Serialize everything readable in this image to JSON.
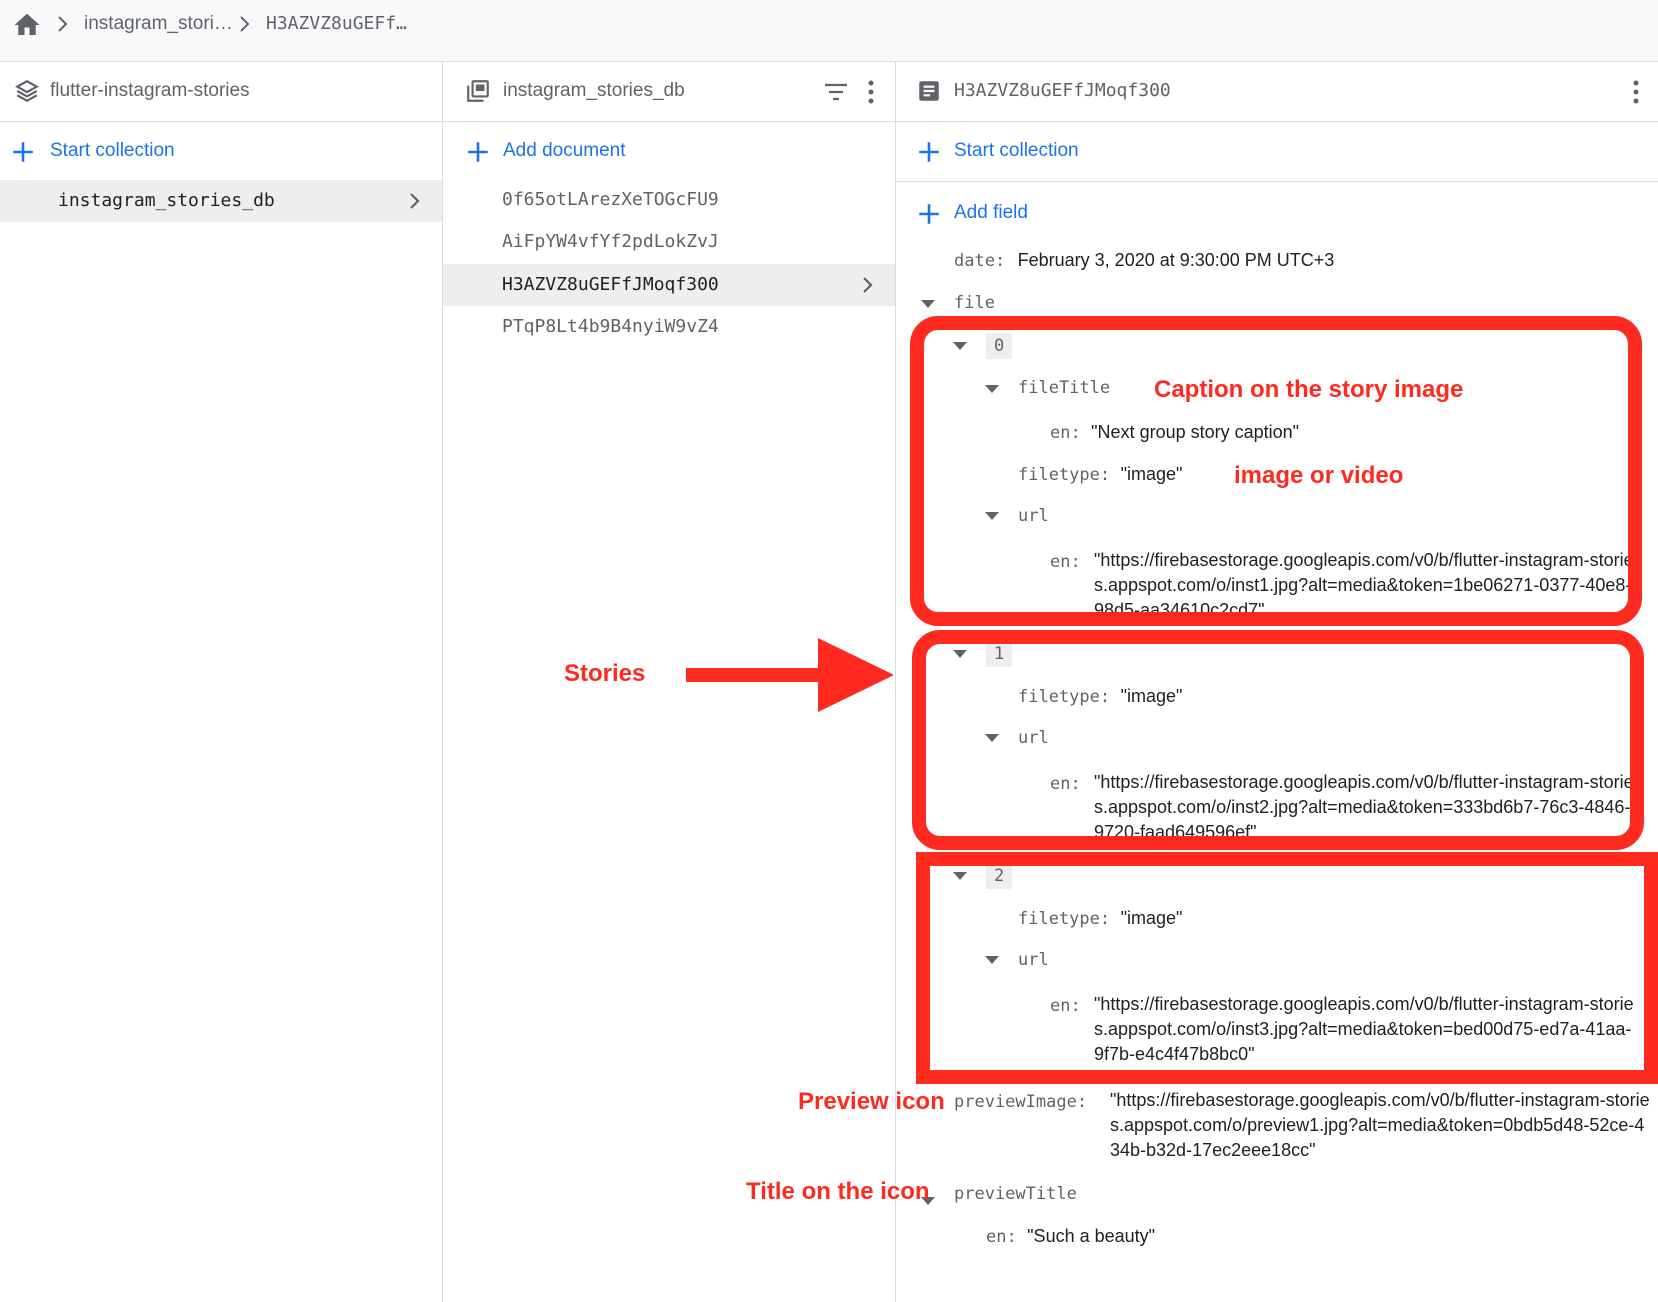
{
  "breadcrumb": {
    "home_icon": "home-icon",
    "items": [
      "instagram_stori…",
      "H3AZVZ8uGEFf…"
    ]
  },
  "column_root": {
    "title": "flutter-instagram-stories",
    "start_collection": "Start collection",
    "collections": [
      {
        "name": "instagram_stories_db",
        "selected": true
      }
    ]
  },
  "column_collection": {
    "title": "instagram_stories_db",
    "add_document": "Add document",
    "documents": [
      {
        "id": "0f65otLArezXeTOGcFU9",
        "selected": false
      },
      {
        "id": "AiFpYW4vfYf2pdLokZvJ",
        "selected": false
      },
      {
        "id": "H3AZVZ8uGEFfJMoqf300",
        "selected": true
      },
      {
        "id": "PTqP8Lt4b9B4nyiW9vZ4",
        "selected": false
      }
    ]
  },
  "column_document": {
    "title": "H3AZVZ8uGEFfJMoqf300",
    "start_collection": "Start collection",
    "add_field": "Add field",
    "fields": {
      "date_key": "date:",
      "date_value": "February 3, 2020 at 9:30:00 PM UTC+3",
      "file_key": "file",
      "items": [
        {
          "index": "0",
          "fileTitle_key": "fileTitle",
          "fileTitle_en_key": "en:",
          "fileTitle_en_value": "\"Next group story caption\"",
          "filetype_key": "filetype:",
          "filetype_value": "\"image\"",
          "url_key": "url",
          "url_en_key": "en:",
          "url_en_value": "\"https://firebasestorage.googleapis.com/v0/b/flutter-instagram-stories.appspot.com/o/inst1.jpg?alt=media&token=1be06271-0377-40e8-98d5-aa34610c2cd7\""
        },
        {
          "index": "1",
          "filetype_key": "filetype:",
          "filetype_value": "\"image\"",
          "url_key": "url",
          "url_en_key": "en:",
          "url_en_value": "\"https://firebasestorage.googleapis.com/v0/b/flutter-instagram-stories.appspot.com/o/inst2.jpg?alt=media&token=333bd6b7-76c3-4846-9720-faad649596ef\""
        },
        {
          "index": "2",
          "filetype_key": "filetype:",
          "filetype_value": "\"image\"",
          "url_key": "url",
          "url_en_key": "en:",
          "url_en_value": "\"https://firebasestorage.googleapis.com/v0/b/flutter-instagram-stories.appspot.com/o/inst3.jpg?alt=media&token=bed00d75-ed7a-41aa-9f7b-e4c4f47b8bc0\""
        }
      ],
      "previewImage_key": "previewImage:",
      "previewImage_value": "\"https://firebasestorage.googleapis.com/v0/b/flutter-instagram-stories.appspot.com/o/preview1.jpg?alt=media&token=0bdb5d48-52ce-434b-b32d-17ec2eee18cc\"",
      "previewTitle_key": "previewTitle",
      "previewTitle_en_key": "en:",
      "previewTitle_en_value": "\"Such a beauty\""
    }
  },
  "annotations": {
    "caption": "Caption on the story image",
    "image_or_video": "image or video",
    "stories": "Stories",
    "preview_icon": "Preview icon",
    "title_on_icon": "Title on the icon",
    "color": "#ff2a1f"
  },
  "colors": {
    "accent": "#1a73e8",
    "selected_bg": "#eeeeee",
    "annotation": "#ff2a1f"
  }
}
